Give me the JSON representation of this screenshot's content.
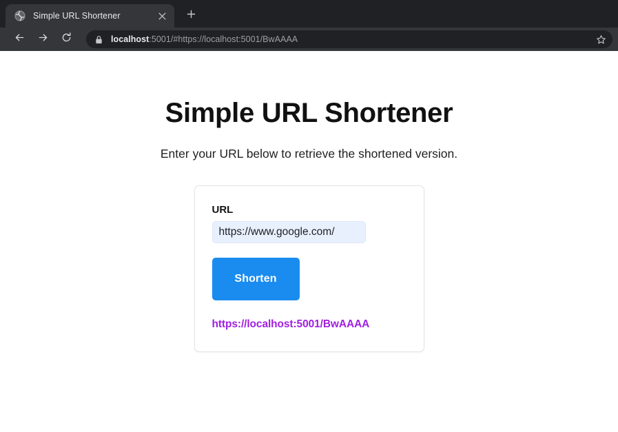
{
  "browser": {
    "tab": {
      "title": "Simple URL Shortener",
      "favicon_icon": "globe-icon",
      "close_icon": "close-icon"
    },
    "new_tab_icon": "plus-icon",
    "nav": {
      "back_icon": "arrow-left-icon",
      "forward_icon": "arrow-right-icon",
      "reload_icon": "reload-icon"
    },
    "omnibox": {
      "lock_icon": "lock-icon",
      "host": "localhost",
      "rest": ":5001/#https://localhost:5001/BwAAAA",
      "full_url": "localhost:5001/#https://localhost:5001/BwAAAA"
    },
    "bookmark_icon": "star-icon"
  },
  "page": {
    "title": "Simple URL Shortener",
    "subtitle": "Enter your URL below to retrieve the shortened version.",
    "card": {
      "field_label": "URL",
      "input_value": "https://www.google.com/",
      "input_placeholder": "https://www.google.com/",
      "submit_label": "Shorten",
      "result_link": "https://localhost:5001/BwAAAA"
    }
  },
  "colors": {
    "accent_button": "#1a8cef",
    "visited_link": "#a020e0",
    "input_autofill": "#e8f0fe",
    "chrome_tabstrip": "#202124",
    "chrome_toolbar": "#35363a"
  }
}
